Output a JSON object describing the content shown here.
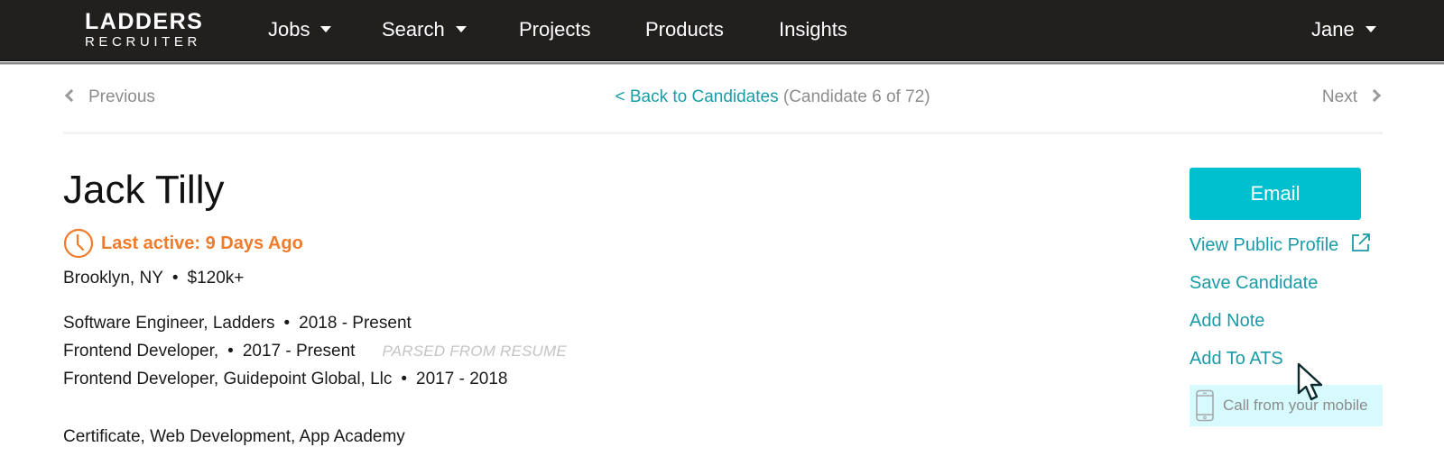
{
  "header": {
    "logo": {
      "top": "LADDERS",
      "bottom": "RECRUITER"
    },
    "nav": [
      {
        "label": "Jobs",
        "has_dropdown": true
      },
      {
        "label": "Search",
        "has_dropdown": true
      },
      {
        "label": "Projects",
        "has_dropdown": false
      },
      {
        "label": "Products",
        "has_dropdown": false
      },
      {
        "label": "Insights",
        "has_dropdown": false
      }
    ],
    "user": {
      "label": "Jane",
      "has_dropdown": true
    }
  },
  "pager": {
    "previous_label": "Previous",
    "next_label": "Next",
    "back_label": "< Back to Candidates",
    "count_text": "(Candidate 6 of 72)",
    "current": 6,
    "total": 72
  },
  "candidate": {
    "name": "Jack Tilly",
    "last_active": "Last active: 9 Days Ago",
    "location": "Brooklyn, NY",
    "salary": "$120k+",
    "experience": [
      {
        "title": "Software Engineer, Ladders",
        "dates": "2018 - Present",
        "tag": ""
      },
      {
        "title": "Frontend Developer,",
        "dates": "2017 - Present",
        "tag": "PARSED FROM RESUME"
      },
      {
        "title": "Frontend Developer, Guidepoint Global, Llc",
        "dates": "2017 - 2018",
        "tag": ""
      }
    ],
    "education": "Certificate, Web Development, App Academy",
    "separator": "•"
  },
  "actions": {
    "email_label": "Email",
    "view_profile_label": "View Public Profile",
    "save_label": "Save Candidate",
    "note_label": "Add Note",
    "ats_label": "Add To ATS",
    "call_label": "Call from your mobile"
  },
  "colors": {
    "nav_bg": "#221f1f",
    "accent": "#00bfcf",
    "link": "#1a9ba8",
    "last_active": "#f07b2a",
    "call_bg": "#d6fafd"
  }
}
